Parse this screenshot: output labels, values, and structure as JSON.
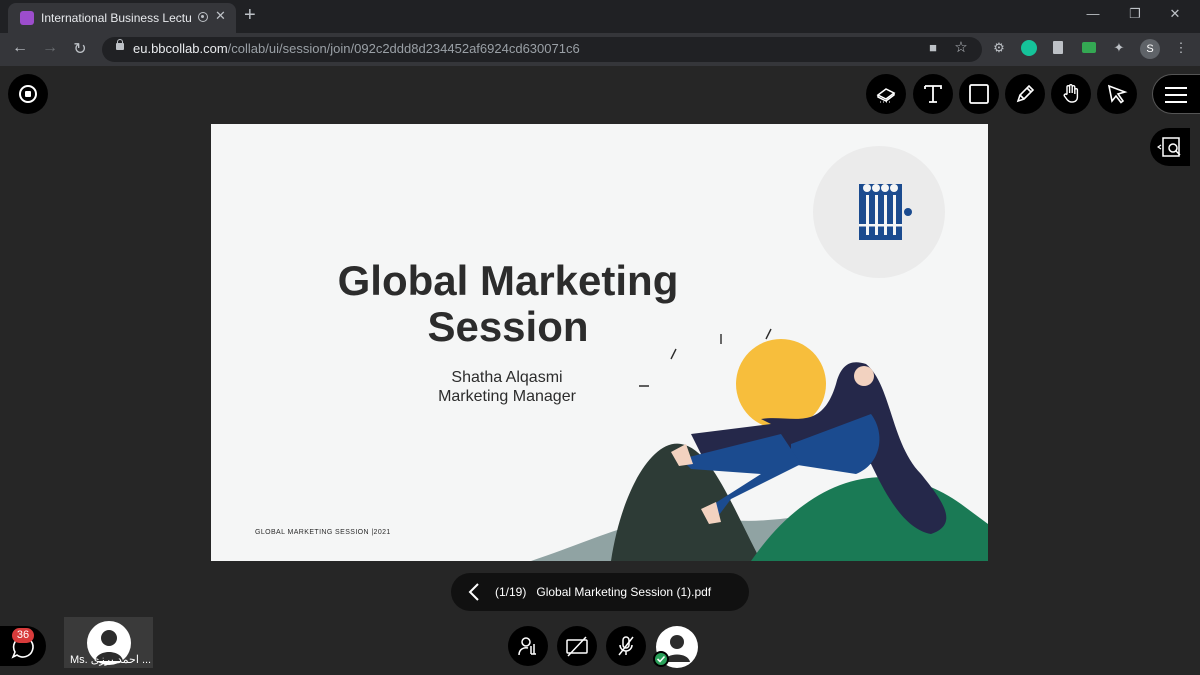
{
  "browser": {
    "tab_title": "International Business Lectur",
    "tab_close": "✕",
    "new_tab": "+",
    "url_host": "eu.bbcollab.com",
    "url_path": "/collab/ui/session/join/092c2ddd8d234452af6924cd630071c6",
    "profile_initial": "S",
    "window_controls": [
      "—",
      "❐",
      "✕"
    ]
  },
  "toolbar": {
    "tools": [
      "eraser-icon",
      "text-tool-icon",
      "shape-icon",
      "pencil-icon",
      "pan-hand-icon",
      "pointer-icon"
    ]
  },
  "slide": {
    "title_line1": "Global Marketing",
    "title_line2": "Session",
    "presenter": "Shatha Alqasmi",
    "role": "Marketing Manager",
    "footer": "GLOBAL MARKETING SESSION |2021"
  },
  "document": {
    "page": "(1/19)",
    "filename": "Global Marketing Session (1).pdf"
  },
  "chat": {
    "unread": "36"
  },
  "participant": {
    "name": "Ms. احمد برزی ..."
  },
  "colors": {
    "accent_navy": "#1b4b8f",
    "bulb_yellow": "#f7be3c",
    "hill_green": "#1a7a55",
    "status_green": "#2aa05a",
    "badge_red": "#d83b3b"
  }
}
